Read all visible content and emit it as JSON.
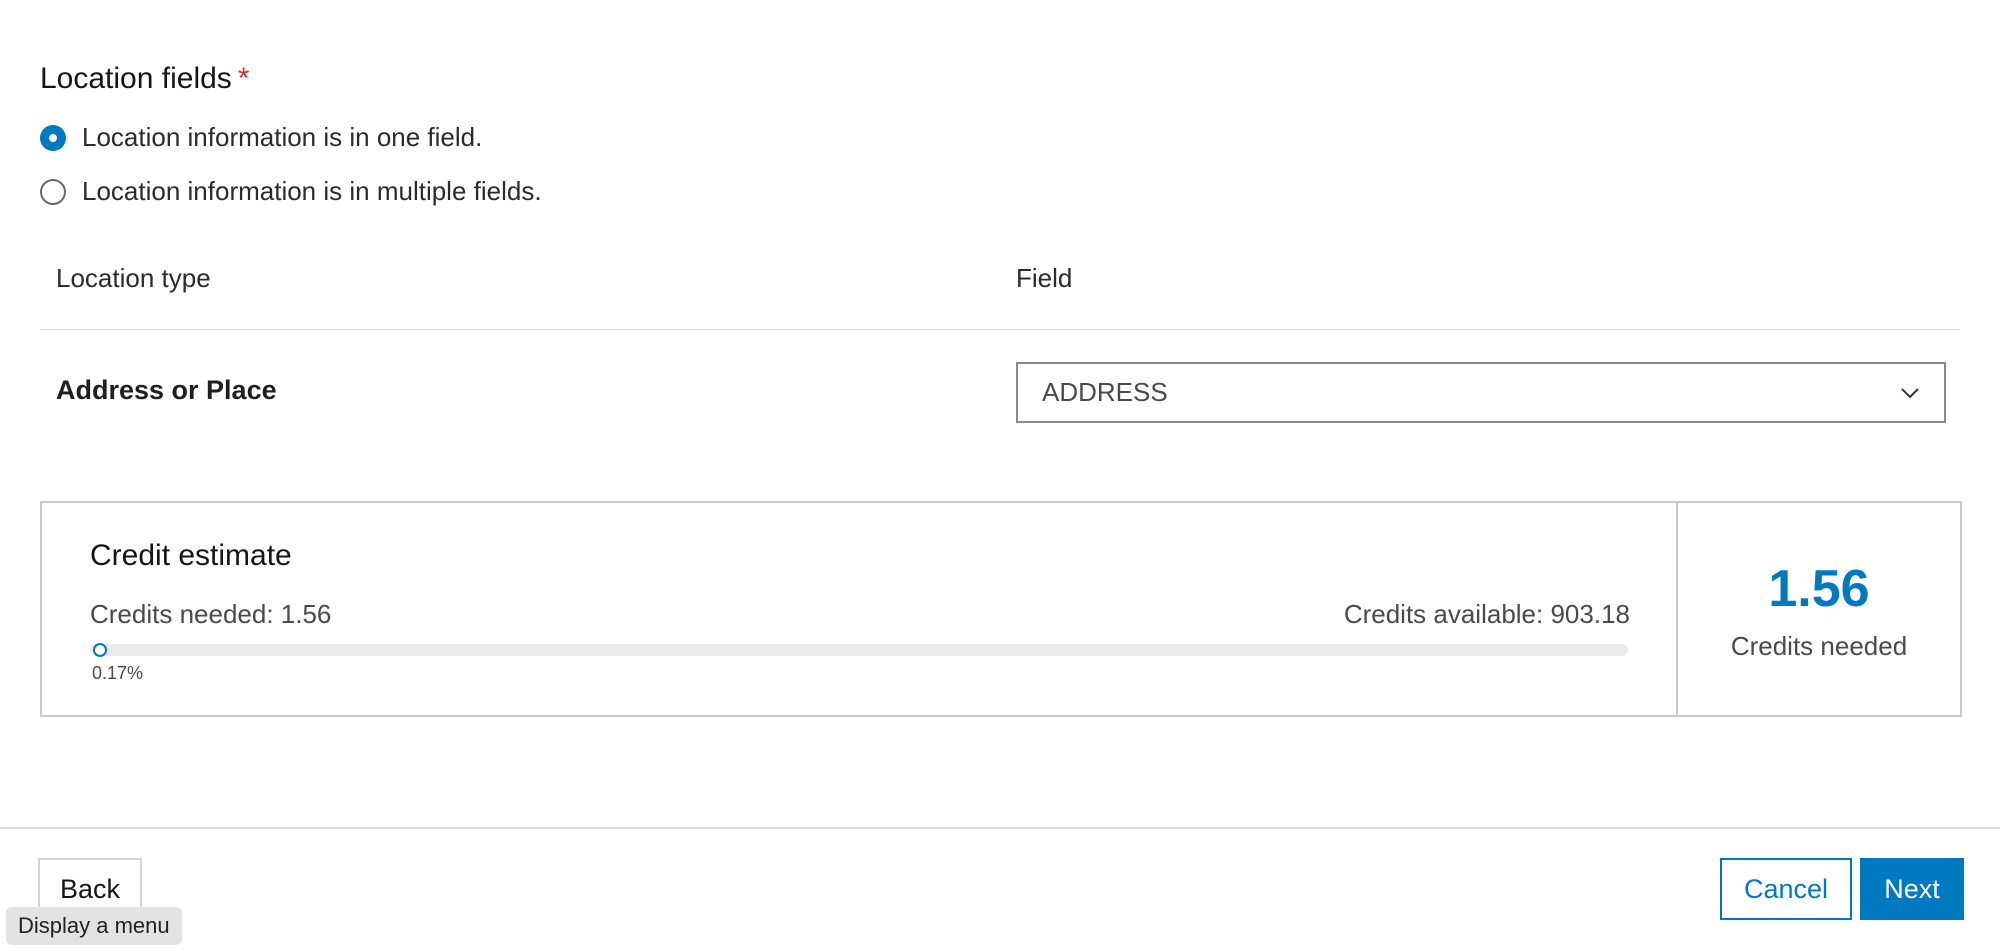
{
  "location_fields": {
    "title": "Location fields",
    "required_marker": "*",
    "options": [
      {
        "label": "Location information is in one field.",
        "selected": true
      },
      {
        "label": "Location information is in multiple fields.",
        "selected": false
      }
    ]
  },
  "table": {
    "headers": {
      "location_type": "Location type",
      "field": "Field"
    },
    "rows": [
      {
        "location_type": "Address or Place",
        "field_value": "ADDRESS"
      }
    ]
  },
  "credit_estimate": {
    "title": "Credit estimate",
    "credits_needed_text": "Credits needed: 1.56",
    "credits_available_text": "Credits available: 903.18",
    "progress_percent": 0.17,
    "progress_label": "0.17%",
    "big_value": "1.56",
    "big_caption": "Credits needed"
  },
  "footer": {
    "back_label": "Back",
    "cancel_label": "Cancel",
    "next_label": "Next"
  },
  "tooltip": {
    "text": "Display a menu"
  },
  "colors": {
    "accent": "#0079c1",
    "required": "#d83020"
  }
}
